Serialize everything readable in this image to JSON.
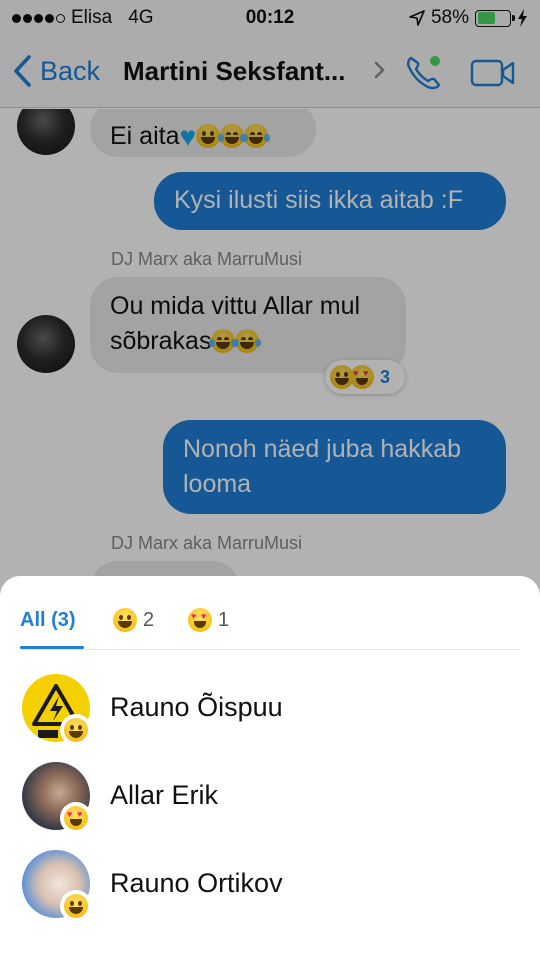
{
  "status_bar": {
    "carrier": "Elisa",
    "network": "4G",
    "time": "00:12",
    "battery": "58%",
    "battery_level": 0.58,
    "signal_bars": 4,
    "signal_max": 5
  },
  "nav": {
    "back_label": "Back",
    "title": "Martini Seksfantasia",
    "title_display": "Martini Seksfant..."
  },
  "messages": [
    {
      "direction": "in",
      "text": "Ei aita",
      "emoji": [
        "blue-heart",
        "grin",
        "laugh-tears",
        "laugh-tears"
      ]
    },
    {
      "direction": "out",
      "text": "Kysi ilusti siis ikka aitab :F"
    },
    {
      "direction": "in",
      "sender": "DJ Marx aka MarruMusi",
      "text_line1": "Ou mida vittu Allar mul",
      "text_line2": "sõbrakas",
      "emoji": [
        "laugh-tears",
        "laugh-tears"
      ],
      "reactions": {
        "icons": [
          "grin",
          "heart-eyes"
        ],
        "count": "3"
      }
    },
    {
      "direction": "out",
      "text_line1": "Nonoh näed juba hakkab",
      "text_line2": "looma"
    },
    {
      "direction": "in",
      "sender": "DJ Marx aka MarruMusi"
    }
  ],
  "reactions_sheet": {
    "tabs": [
      {
        "label": "All (3)",
        "selected": true
      },
      {
        "icon": "grin",
        "count": "2"
      },
      {
        "icon": "heart-eyes",
        "count": "1"
      }
    ],
    "people": [
      {
        "name": "Rauno Õispuu",
        "reaction": "grin"
      },
      {
        "name": "Allar Erik",
        "reaction": "heart-eyes"
      },
      {
        "name": "Rauno Ortikov",
        "reaction": "grin"
      }
    ]
  },
  "colors": {
    "accent": "#1f7ed6",
    "bubble_in": "#eaeaea",
    "bubble_out": "#1f7ed6",
    "battery": "#4cd964"
  }
}
